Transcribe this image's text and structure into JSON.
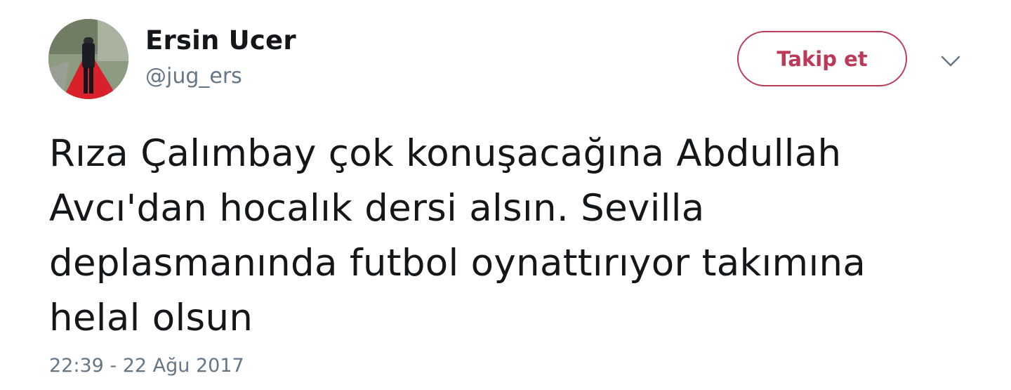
{
  "user": {
    "display_name": "Ersin Ucer",
    "handle": "@jug_ers",
    "avatar_icon": "profile-photo"
  },
  "actions": {
    "follow_label": "Takip et",
    "caret_icon": "chevron-down-icon"
  },
  "tweet": {
    "text": "Rıza Çalımbay çok konuşacağına Abdullah\nAvcı'dan hocalık dersi alsın. Sevilla\ndeplasmanında futbol oynattırıyor takımına\nhelal olsun",
    "timestamp": "22:39 - 22 Ağu 2017"
  },
  "colors": {
    "accent": "#bb3a58",
    "secondary_text": "#657786",
    "primary_text": "#14171a"
  }
}
